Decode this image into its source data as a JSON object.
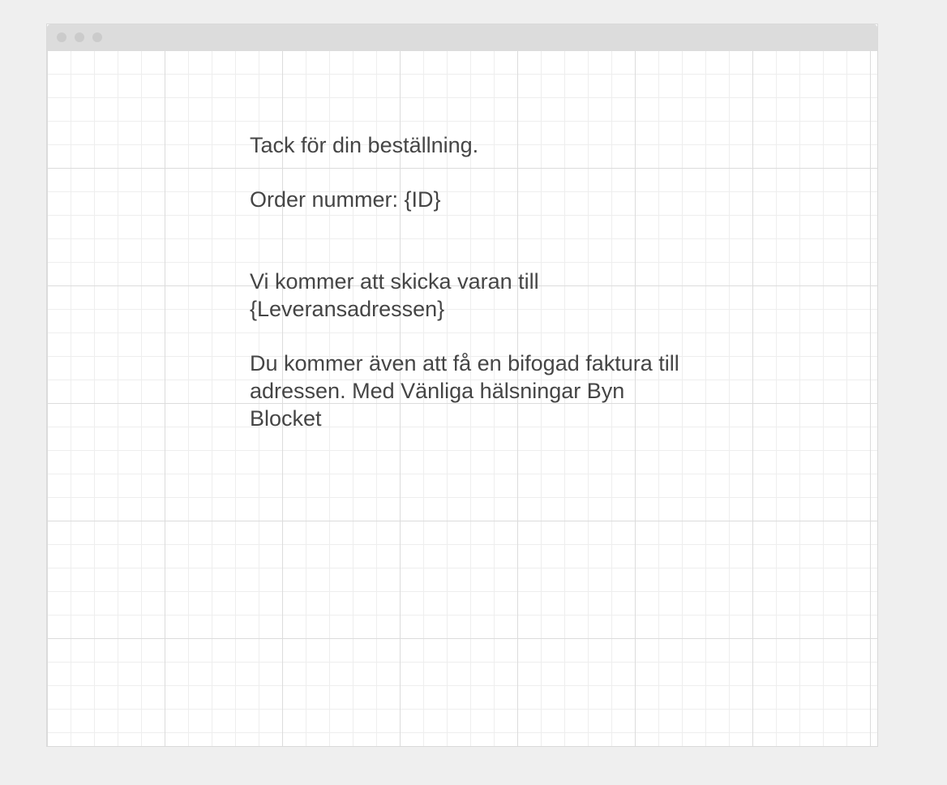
{
  "message": {
    "thanks": "Tack för din beställning.",
    "order_number": "Order nummer: {ID}",
    "shipping": "Vi kommer att skicka varan till {Leveransadressen}",
    "invoice": "Du kommer även att få en bifogad faktura till adressen. Med Vänliga hälsningar Byn Blocket"
  },
  "colors": {
    "text": "#454545",
    "titlebar": "#dcdcdc",
    "window_dot": "#cbcbcb",
    "grid_major": "#dcdcdc",
    "grid_minor": "#eeeeee",
    "background": "#efefef"
  }
}
